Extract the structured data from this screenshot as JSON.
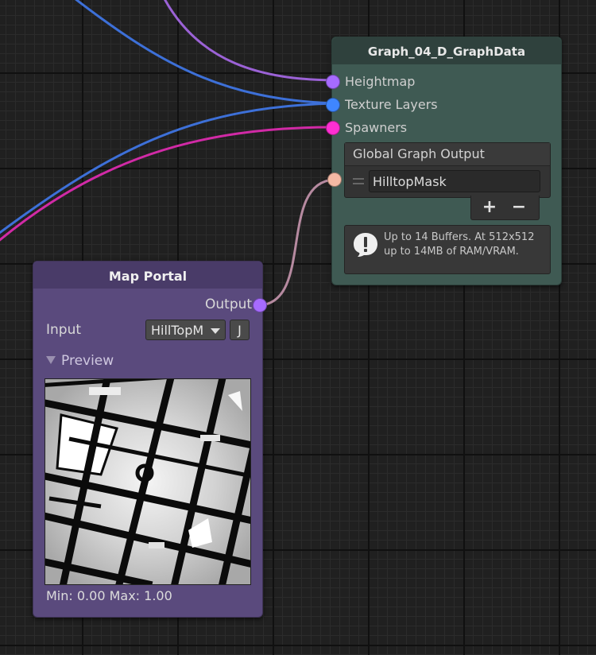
{
  "graph_node": {
    "title": "Graph_04_D_GraphData",
    "ports": [
      {
        "label": "Heightmap",
        "color": "#a66bff"
      },
      {
        "label": "Texture Layers",
        "color": "#3f86ff"
      },
      {
        "label": "Spawners",
        "color": "#ff2fd2"
      }
    ],
    "global_output": {
      "header": "Global Graph Output",
      "items": [
        {
          "name": "HilltopMask",
          "port_color": "#f4b9a4"
        }
      ],
      "add_label": "+",
      "remove_label": "−"
    },
    "help_message": "Up to 14 Buffers. At 512x512\nup to 14MB of RAM/VRAM."
  },
  "portal_node": {
    "title": "Map Portal",
    "output_label": "Output",
    "output_color": "#a66bff",
    "input_label": "Input",
    "input_value": "HillTopM",
    "j_label": "J",
    "preview_label": "Preview",
    "range_text": "Min: 0.00 Max: 1.00"
  },
  "wire_colors": {
    "heightmap": "#9b62d6",
    "texture": "#3d70d8",
    "spawners": "#d12aa6",
    "output": "#b68aa0"
  }
}
